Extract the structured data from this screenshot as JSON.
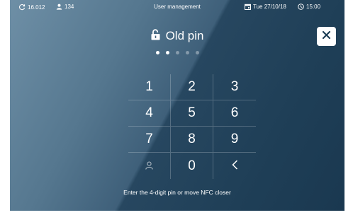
{
  "status_bar": {
    "sync_value": "16.012",
    "users_value": "134",
    "title": "User management",
    "date": "Tue 27/10/18",
    "time": "15:00"
  },
  "header": {
    "title": "Old pin"
  },
  "pin": {
    "length": 5,
    "entered": 2
  },
  "keypad": {
    "keys": [
      "1",
      "2",
      "3",
      "4",
      "5",
      "6",
      "7",
      "8",
      "9",
      "0"
    ]
  },
  "hint": "Enter the 4-digit pin or move NFC closer",
  "colors": {
    "panel_light": "#6e8fa6",
    "panel_dark": "#1f3f57",
    "text": "#ffffff"
  }
}
